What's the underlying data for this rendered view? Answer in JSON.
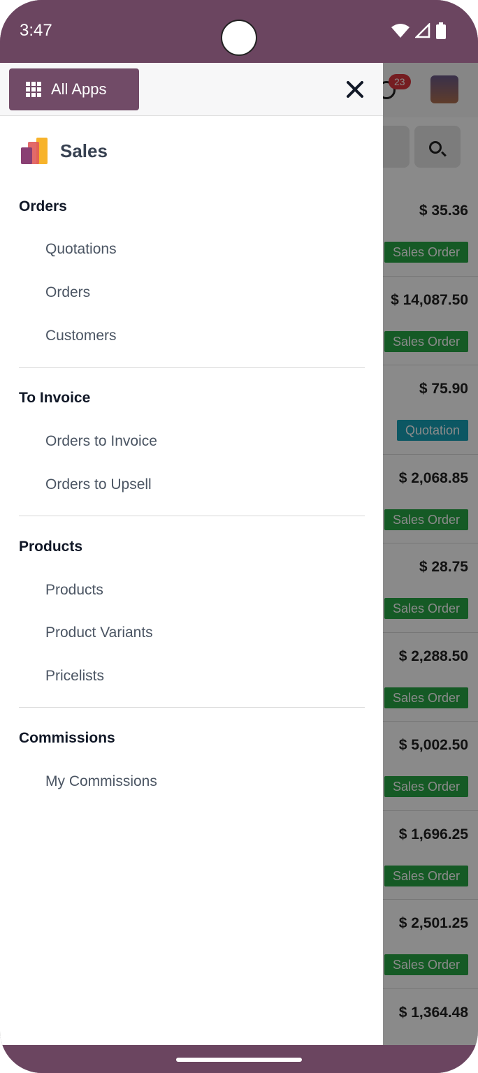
{
  "status_bar": {
    "time": "3:47"
  },
  "drawer": {
    "all_apps_label": "All Apps",
    "app_name": "Sales",
    "sections": [
      {
        "title": "Orders",
        "items": [
          "Quotations",
          "Orders",
          "Customers"
        ]
      },
      {
        "title": "To Invoice",
        "items": [
          "Orders to Invoice",
          "Orders to Upsell"
        ]
      },
      {
        "title": "Products",
        "items": [
          "Products",
          "Product Variants",
          "Pricelists"
        ]
      },
      {
        "title": "Commissions",
        "items": [
          "My Commissions"
        ]
      }
    ]
  },
  "background": {
    "notification_count": "23",
    "rows": [
      {
        "amount": "$ 35.36",
        "state": "Sales Order"
      },
      {
        "amount": "$ 14,087.50",
        "state": "Sales Order"
      },
      {
        "amount": "$ 75.90",
        "state": "Quotation"
      },
      {
        "amount": "$ 2,068.85",
        "state": "Sales Order"
      },
      {
        "amount": "$ 28.75",
        "state": "Sales Order"
      },
      {
        "amount": "$ 2,288.50",
        "state": "Sales Order"
      },
      {
        "amount": "$ 5,002.50",
        "state": "Sales Order"
      },
      {
        "amount": "$ 1,696.25",
        "state": "Sales Order"
      },
      {
        "amount": "$ 2,501.25",
        "state": "Sales Order"
      },
      {
        "amount": "$ 1,364.48",
        "state": ""
      }
    ]
  },
  "colors": {
    "brand": "#714b67",
    "frame": "#6b4560",
    "sales_order": "#28a745",
    "quotation": "#17a2b8"
  }
}
